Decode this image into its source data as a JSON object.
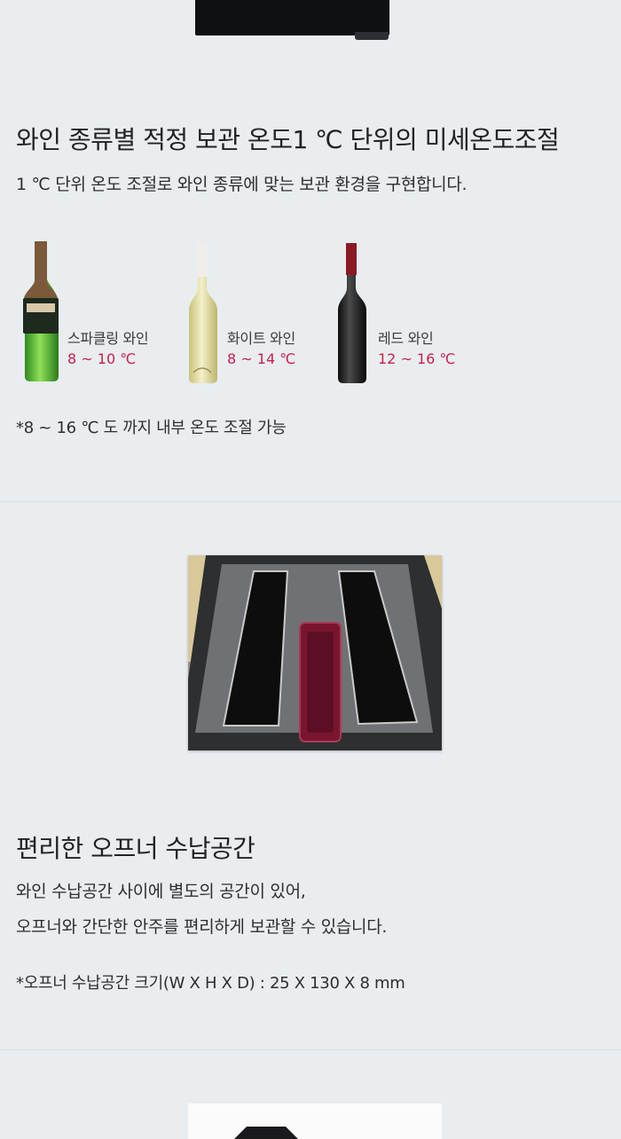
{
  "section_temp": {
    "title": "와인 종류별 적정 보관 온도1 ℃ 단위의 미세온도조절",
    "description": "1 ℃ 단위 온도 조절로 와인 종류에 맞는 보관 환경을 구현합니다.",
    "wines": [
      {
        "name": "스파클링 와인",
        "temp": "8 ~ 10 ℃"
      },
      {
        "name": "화이트 와인",
        "temp": "8 ~ 14 ℃"
      },
      {
        "name": "레드 와인",
        "temp": "12 ~ 16 ℃"
      }
    ],
    "note": "*8 ~ 16 ℃ 도 까지 내부 온도 조절 가능"
  },
  "section_opener": {
    "title": "편리한 오프너 수납공간",
    "line1": "와인 수납공간 사이에 별도의 공간이 있어,",
    "line2": "오프너와 간단한 안주를 편리하게 보관할 수 있습니다.",
    "note": "*오프너 수납공간 크기(W X H X D) : 25 X 130 X 8 mm"
  },
  "colors": {
    "background": "#e9edf0",
    "temp_accent": "#c8204c",
    "opener_tray": "#7a1530"
  }
}
